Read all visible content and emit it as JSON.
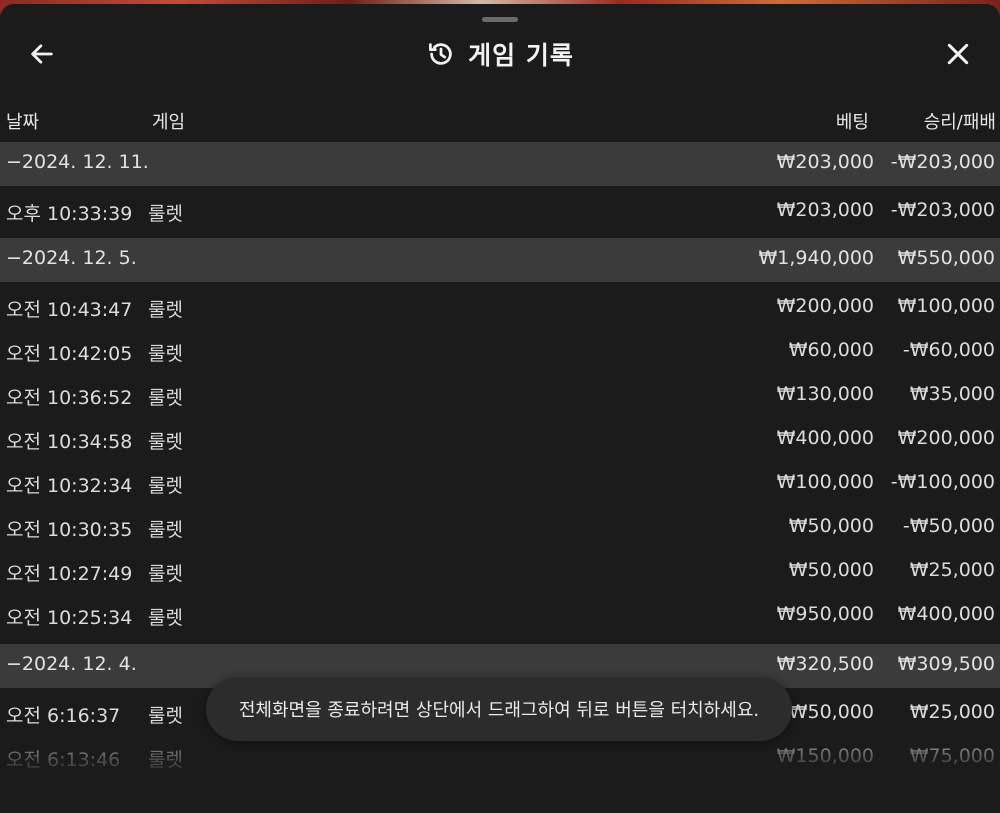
{
  "header": {
    "title": "게임 기록",
    "back_icon": "arrow-left-icon",
    "history_icon": "history-icon",
    "close_icon": "close-icon"
  },
  "columns": {
    "date": "날짜",
    "game": "게임",
    "bet": "베팅",
    "win_loss": "승리/패배"
  },
  "rows": [
    {
      "type": "group",
      "date": "−2024. 12. 11.",
      "game": "",
      "bet": "₩203,000",
      "result": "-₩203,000"
    },
    {
      "type": "item",
      "date": "오후 10:33:39",
      "game": "룰렛",
      "bet": "₩203,000",
      "result": "-₩203,000"
    },
    {
      "type": "group",
      "date": "−2024. 12. 5.",
      "game": "",
      "bet": "₩1,940,000",
      "result": "₩550,000"
    },
    {
      "type": "item",
      "date": "오전 10:43:47",
      "game": "룰렛",
      "bet": "₩200,000",
      "result": "₩100,000"
    },
    {
      "type": "item",
      "date": "오전 10:42:05",
      "game": "룰렛",
      "bet": "₩60,000",
      "result": "-₩60,000"
    },
    {
      "type": "item",
      "date": "오전 10:36:52",
      "game": "룰렛",
      "bet": "₩130,000",
      "result": "₩35,000"
    },
    {
      "type": "item",
      "date": "오전 10:34:58",
      "game": "룰렛",
      "bet": "₩400,000",
      "result": "₩200,000"
    },
    {
      "type": "item",
      "date": "오전 10:32:34",
      "game": "룰렛",
      "bet": "₩100,000",
      "result": "-₩100,000"
    },
    {
      "type": "item",
      "date": "오전 10:30:35",
      "game": "룰렛",
      "bet": "₩50,000",
      "result": "-₩50,000"
    },
    {
      "type": "item",
      "date": "오전 10:27:49",
      "game": "룰렛",
      "bet": "₩50,000",
      "result": "₩25,000"
    },
    {
      "type": "item",
      "date": "오전 10:25:34",
      "game": "룰렛",
      "bet": "₩950,000",
      "result": "₩400,000"
    },
    {
      "type": "group",
      "date": "−2024. 12. 4.",
      "game": "",
      "bet": "₩320,500",
      "result": "₩309,500"
    },
    {
      "type": "item",
      "date": "오전 6:16:37",
      "game": "룰렛",
      "bet": "₩50,000",
      "result": "₩25,000"
    },
    {
      "type": "item",
      "date": "오전 6:13:46",
      "game": "룰렛",
      "bet": "₩150,000",
      "result": "₩75,000"
    }
  ],
  "toast": {
    "message": "전체화면을 종료하려면 상단에서 드래그하여 뒤로 버튼을 터치하세요."
  }
}
